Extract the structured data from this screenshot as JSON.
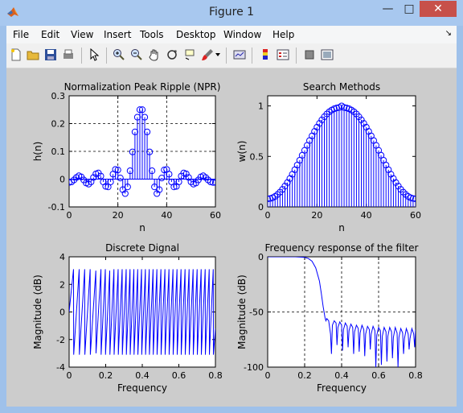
{
  "window": {
    "title": "Figure 1"
  },
  "titlebar_buttons": {
    "minimize": "—",
    "maximize": "□",
    "close": "✕"
  },
  "menubar": {
    "items": [
      {
        "id": "file",
        "label": "File"
      },
      {
        "id": "edit",
        "label": "Edit"
      },
      {
        "id": "view",
        "label": "View"
      },
      {
        "id": "insert",
        "label": "Insert"
      },
      {
        "id": "tools",
        "label": "Tools"
      },
      {
        "id": "desktop",
        "label": "Desktop"
      },
      {
        "id": "window",
        "label": "Window"
      },
      {
        "id": "help",
        "label": "Help"
      }
    ],
    "dock_arrow": "↘"
  },
  "toolbar": {
    "icons": [
      "new-figure-icon",
      "open-file-icon",
      "save-icon",
      "print-icon",
      "pointer-icon",
      "zoom-in-icon",
      "zoom-out-icon",
      "pan-hand-icon",
      "rotate-3d-icon",
      "data-cursor-icon",
      "brush-icon",
      "brush-dropdown-icon",
      "link-plot-icon",
      "colorbar-icon",
      "legend-icon",
      "hide-plot-tools-icon",
      "show-plot-tools-icon"
    ]
  },
  "colors": {
    "plot_line": "#0000ff",
    "axes_bg": "#ffffff",
    "figure_bg": "#cccccc",
    "close_button": "#c7504a"
  },
  "chart_data": [
    {
      "type": "stem",
      "title": "Normalization Peak Ripple (NPR)",
      "xlabel": "n",
      "ylabel": "h(n)",
      "xlim": [
        0,
        60
      ],
      "ylim": [
        -0.1,
        0.3
      ],
      "xticks": [
        "0",
        "20",
        "40",
        "60"
      ],
      "yticks": [
        "-0.1",
        "0",
        "0.1",
        "0.2",
        "0.3"
      ],
      "grid": true,
      "x": [
        0,
        1,
        2,
        3,
        4,
        5,
        6,
        7,
        8,
        9,
        10,
        11,
        12,
        13,
        14,
        15,
        16,
        17,
        18,
        19,
        20,
        21,
        22,
        23,
        24,
        25,
        26,
        27,
        28,
        29,
        30,
        31,
        32,
        33,
        34,
        35,
        36,
        37,
        38,
        39,
        40,
        41,
        42,
        43,
        44,
        45,
        46,
        47,
        48,
        49,
        50,
        51,
        52,
        53,
        54,
        55,
        56,
        57,
        58,
        59,
        60
      ],
      "y": [
        -0.012,
        -0.01,
        -0.003,
        0.006,
        0.012,
        0.008,
        -0.003,
        -0.014,
        -0.018,
        -0.01,
        0.006,
        0.019,
        0.022,
        0.011,
        -0.01,
        -0.026,
        -0.028,
        -0.01,
        0.018,
        0.035,
        0.033,
        0.004,
        -0.038,
        -0.052,
        -0.028,
        0.03,
        0.098,
        0.17,
        0.223,
        0.25,
        0.25,
        0.223,
        0.17,
        0.098,
        0.03,
        -0.028,
        -0.052,
        -0.038,
        0.004,
        0.033,
        0.035,
        0.018,
        -0.01,
        -0.028,
        -0.026,
        -0.01,
        0.011,
        0.022,
        0.019,
        0.006,
        -0.01,
        -0.018,
        -0.014,
        -0.003,
        0.008,
        0.012,
        0.006,
        -0.003,
        -0.01,
        -0.012,
        -0.012
      ]
    },
    {
      "type": "stem",
      "title": "Search Methods",
      "xlabel": "n",
      "ylabel": "w(n)",
      "xlim": [
        0,
        60
      ],
      "ylim": [
        0,
        1.1
      ],
      "xticks": [
        "0",
        "20",
        "40",
        "60"
      ],
      "yticks": [
        "0",
        "0.5",
        "1"
      ],
      "grid": false,
      "x": [
        0,
        1,
        2,
        3,
        4,
        5,
        6,
        7,
        8,
        9,
        10,
        11,
        12,
        13,
        14,
        15,
        16,
        17,
        18,
        19,
        20,
        21,
        22,
        23,
        24,
        25,
        26,
        27,
        28,
        29,
        30,
        31,
        32,
        33,
        34,
        35,
        36,
        37,
        38,
        39,
        40,
        41,
        42,
        43,
        44,
        45,
        46,
        47,
        48,
        49,
        50,
        51,
        52,
        53,
        54,
        55,
        56,
        57,
        58,
        59,
        60
      ],
      "y": [
        0.08,
        0.083,
        0.091,
        0.104,
        0.123,
        0.146,
        0.174,
        0.206,
        0.241,
        0.281,
        0.323,
        0.368,
        0.414,
        0.462,
        0.511,
        0.56,
        0.609,
        0.657,
        0.703,
        0.747,
        0.789,
        0.827,
        0.862,
        0.893,
        0.92,
        0.942,
        0.959,
        0.972,
        0.98,
        0.985,
        1.0,
        0.985,
        0.98,
        0.972,
        0.959,
        0.942,
        0.92,
        0.893,
        0.862,
        0.827,
        0.789,
        0.747,
        0.703,
        0.657,
        0.609,
        0.56,
        0.511,
        0.462,
        0.414,
        0.368,
        0.323,
        0.281,
        0.241,
        0.206,
        0.174,
        0.146,
        0.123,
        0.104,
        0.091,
        0.083,
        0.08
      ]
    },
    {
      "type": "line",
      "title": "Discrete Dignal",
      "xlabel": "Frequency",
      "ylabel": "Magnitude (dB)",
      "xlim": [
        0,
        0.8
      ],
      "ylim": [
        -4,
        4
      ],
      "xticks": [
        "0",
        "0.2",
        "0.4",
        "0.6",
        "0.8"
      ],
      "yticks": [
        "-4",
        "-2",
        "0",
        "2",
        "4"
      ],
      "grid": false,
      "x": [
        0.0,
        0.024,
        0.025,
        0.055,
        0.056,
        0.085,
        0.086,
        0.115,
        0.116,
        0.146,
        0.147,
        0.174,
        0.175,
        0.198,
        0.199,
        0.222,
        0.223,
        0.245,
        0.246,
        0.268,
        0.269,
        0.29,
        0.291,
        0.312,
        0.313,
        0.333,
        0.334,
        0.354,
        0.355,
        0.375,
        0.376,
        0.396,
        0.397,
        0.417,
        0.418,
        0.438,
        0.439,
        0.459,
        0.46,
        0.48,
        0.481,
        0.502,
        0.503,
        0.524,
        0.525,
        0.546,
        0.547,
        0.568,
        0.569,
        0.59,
        0.591,
        0.612,
        0.613,
        0.634,
        0.635,
        0.656,
        0.657,
        0.678,
        0.679,
        0.7,
        0.701,
        0.722,
        0.723,
        0.744,
        0.745,
        0.766,
        0.767,
        0.788,
        0.789,
        0.8
      ],
      "y": [
        0.0,
        3.1,
        -3.1,
        3.1,
        -3.1,
        3.1,
        -3.1,
        3.1,
        -3.1,
        3.0,
        -3.0,
        3.1,
        -3.1,
        3.1,
        -3.1,
        3.0,
        -3.1,
        3.1,
        -3.1,
        3.1,
        -3.1,
        3.1,
        -3.1,
        3.1,
        -3.1,
        3.1,
        -3.1,
        3.1,
        -3.1,
        3.1,
        -3.1,
        3.1,
        -3.1,
        3.1,
        -3.1,
        3.1,
        -3.1,
        3.1,
        -3.1,
        3.1,
        -3.1,
        3.1,
        -3.1,
        3.1,
        -3.1,
        3.1,
        -3.1,
        3.1,
        -3.1,
        3.1,
        -3.1,
        3.1,
        -3.1,
        3.1,
        -3.1,
        3.1,
        -3.1,
        3.1,
        -3.1,
        3.1,
        -3.1,
        3.1,
        -3.1,
        3.1,
        -3.1,
        3.1,
        -3.1,
        3.1,
        -3.1,
        -1.2
      ]
    },
    {
      "type": "line",
      "title": "Frequency response of the filter",
      "xlabel": "Frequency",
      "ylabel": "Magnitude (dB)",
      "xlim": [
        0,
        0.8
      ],
      "ylim": [
        -100,
        0
      ],
      "xticks": [
        "0",
        "0.2",
        "0.4",
        "0.6",
        "0.8"
      ],
      "yticks": [
        "-100",
        "-50",
        "0"
      ],
      "grid": true,
      "x": [
        0.0,
        0.05,
        0.1,
        0.15,
        0.2,
        0.22,
        0.24,
        0.26,
        0.28,
        0.29,
        0.3,
        0.31,
        0.315,
        0.32,
        0.33,
        0.34,
        0.345,
        0.35,
        0.36,
        0.37,
        0.375,
        0.38,
        0.39,
        0.4,
        0.405,
        0.41,
        0.42,
        0.43,
        0.435,
        0.44,
        0.45,
        0.46,
        0.465,
        0.47,
        0.48,
        0.49,
        0.495,
        0.5,
        0.51,
        0.52,
        0.525,
        0.53,
        0.54,
        0.55,
        0.555,
        0.56,
        0.57,
        0.58,
        0.585,
        0.59,
        0.6,
        0.61,
        0.615,
        0.62,
        0.63,
        0.64,
        0.645,
        0.65,
        0.66,
        0.67,
        0.675,
        0.68,
        0.69,
        0.7,
        0.705,
        0.71,
        0.72,
        0.73,
        0.735,
        0.74,
        0.75,
        0.76,
        0.765,
        0.77,
        0.78,
        0.79,
        0.795,
        0.8
      ],
      "y": [
        0,
        0,
        0,
        0,
        -0.5,
        -1.5,
        -4,
        -10,
        -22,
        -33,
        -45,
        -55,
        -58,
        -56,
        -58,
        -70,
        -88,
        -62,
        -58,
        -60,
        -80,
        -64,
        -59,
        -62,
        -85,
        -66,
        -60,
        -63,
        -82,
        -67,
        -61,
        -64,
        -88,
        -68,
        -62,
        -65,
        -86,
        -69,
        -62,
        -66,
        -90,
        -70,
        -63,
        -66,
        -84,
        -70,
        -63,
        -67,
        -100,
        -71,
        -64,
        -67,
        -98,
        -72,
        -64,
        -68,
        -95,
        -72,
        -64,
        -68,
        -92,
        -73,
        -64,
        -69,
        -100,
        -73,
        -65,
        -69,
        -88,
        -74,
        -65,
        -70,
        -84,
        -74,
        -65,
        -70,
        -82,
        -66
      ]
    }
  ]
}
